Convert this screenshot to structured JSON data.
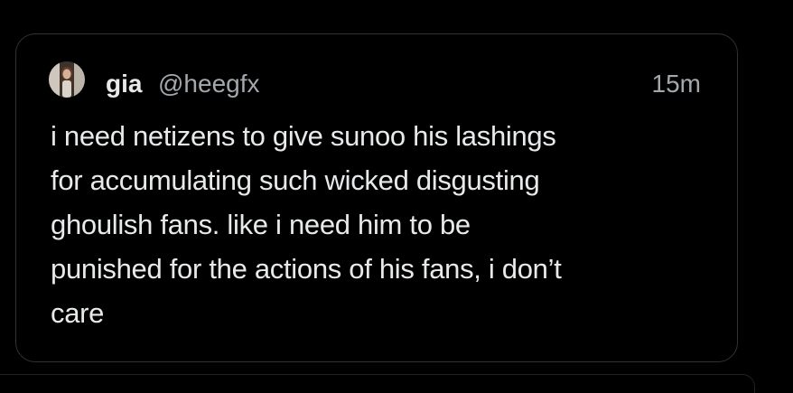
{
  "tweet": {
    "display_name": "gia",
    "handle": "@heegfx",
    "timestamp": "15m",
    "text_lines": [
      "i need netizens to give sunoo his lashings",
      "for accumulating such wicked disgusting",
      "ghoulish fans. like i need him to be",
      "punished for the actions of his fans, i don’t",
      "care"
    ]
  },
  "colors": {
    "background": "#000000",
    "text_primary": "#e7e9ea",
    "text_secondary": "#a3a8ad",
    "border": "#2f3336"
  },
  "icons": {
    "avatar": "user-avatar-photo"
  }
}
